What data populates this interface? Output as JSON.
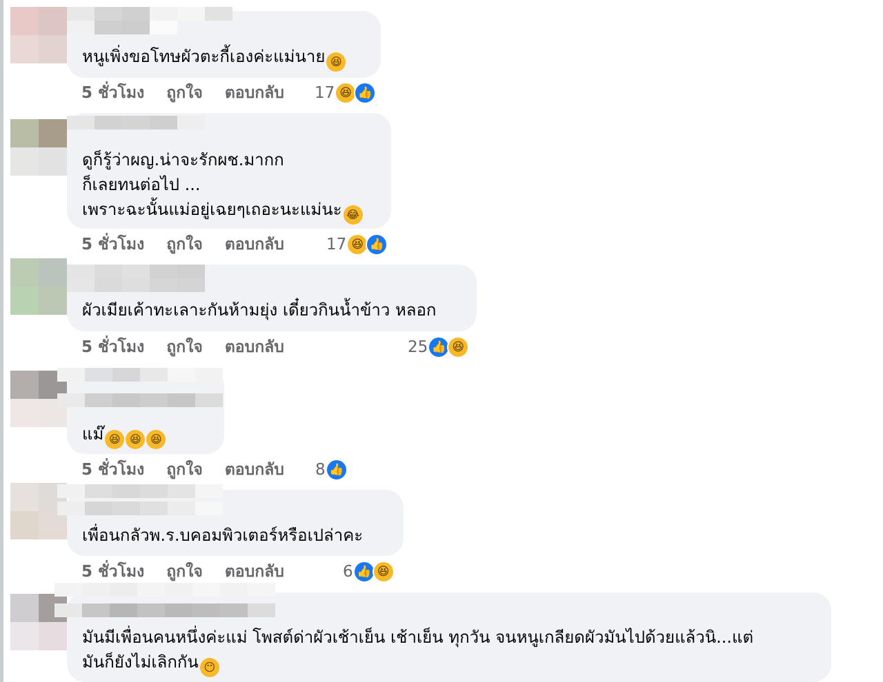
{
  "labels": {
    "time": "5 ชั่วโมง",
    "like": "ถูกใจ",
    "reply": "ตอบกลับ"
  },
  "icons": {
    "like": "like-icon",
    "haha": "haha-icon",
    "rofl": "rofl-emoji",
    "joy": "joy-emoji",
    "neutral": "neutral-face-emoji"
  },
  "colors": {
    "bubble": "#f0f2f5",
    "meta": "#65676b",
    "like": "#1877f2",
    "haha": "#f7b928"
  },
  "comments": [
    {
      "text": "หนูเพิ่งขอโทษผัวตะกี้เองค่ะแม่นาย",
      "reaction_count": "17"
    },
    {
      "text": "ดูก็รู้ว่าผญ.น่าจะรักผช.มากก\nก็เลยทนต่อไป ...\nเพราะฉะนั้นแม่อยู่เฉยๆเถอะนะแม่นะ",
      "reaction_count": "17"
    },
    {
      "text": "ผัวเมียเค้าทะเลาะกันห้ามยุ่ง เดี๋ยวกินน้ำข้าว หลอก",
      "reaction_count": "25"
    },
    {
      "text": "แม๊",
      "reaction_count": "8"
    },
    {
      "text": "เพื่อนกลัวพ.ร.บคอมพิวเตอร์หรือเปล่าคะ",
      "reaction_count": "6"
    },
    {
      "text": "มันมีเพื่อนคนหนึ่งค่ะแม่ โพสต์ด่าผัวเช้าเย็น เช้าเย็น ทุกวัน จนหนูเกลียดผัวมันไปด้วยแล้วนิ...แต่\nมันก็ยังไม่เลิกกัน"
    }
  ]
}
